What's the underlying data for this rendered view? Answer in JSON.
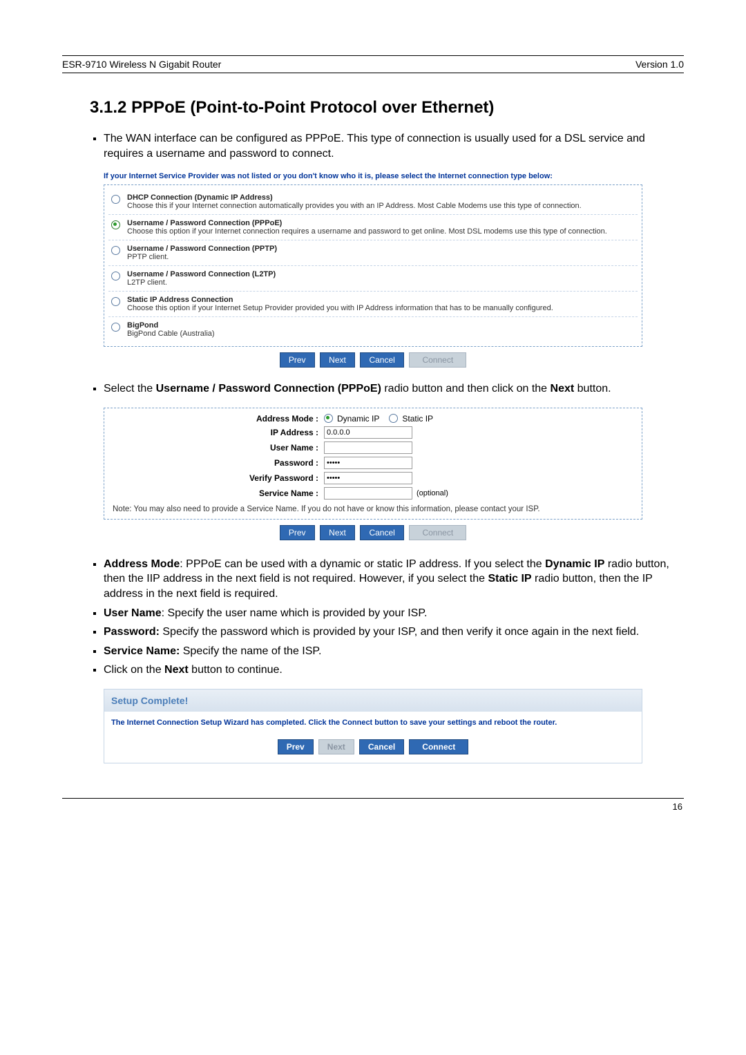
{
  "header": {
    "left": "ESR-9710 Wireless N Gigabit Router",
    "right": "Version 1.0"
  },
  "section": {
    "number": "3.1.2",
    "title": "PPPoE (Point-to-Point Protocol over Ethernet)"
  },
  "intro_bullet": "The WAN interface can be configured as PPPoE. This type of connection is usually used for a DSL service and requires a username and password to connect.",
  "wizard1": {
    "instruction": "If your Internet Service Provider was not listed or you don't know who it is, please select the Internet connection type below:",
    "options": [
      {
        "title": "DHCP Connection (Dynamic IP Address)",
        "desc": "Choose this if your Internet connection automatically provides you with an IP Address. Most Cable Modems use this type of connection.",
        "selected": false
      },
      {
        "title": "Username / Password Connection (PPPoE)",
        "desc": "Choose this option if your Internet connection requires a username and password to get online. Most DSL modems use this type of connection.",
        "selected": true
      },
      {
        "title": "Username / Password Connection (PPTP)",
        "desc": "PPTP client.",
        "selected": false
      },
      {
        "title": "Username / Password Connection (L2TP)",
        "desc": "L2TP client.",
        "selected": false
      },
      {
        "title": "Static IP Address Connection",
        "desc": "Choose this option if your Internet Setup Provider provided you with IP Address information that has to be manually configured.",
        "selected": false
      },
      {
        "title": "BigPond",
        "desc": "BigPond Cable (Australia)",
        "selected": false
      }
    ],
    "buttons": {
      "prev": "Prev",
      "next": "Next",
      "cancel": "Cancel",
      "connect": "Connect"
    }
  },
  "mid_bullet": {
    "prefix": "Select the ",
    "bold1": "Username / Password Connection (PPPoE)",
    "mid": " radio button and then click on the ",
    "bold2": "Next",
    "suffix": " button."
  },
  "form": {
    "labels": {
      "address_mode": "Address Mode :",
      "ip_address": "IP Address :",
      "user_name": "User Name :",
      "password": "Password :",
      "verify_password": "Verify Password :",
      "service_name": "Service Name :"
    },
    "address_mode": {
      "dynamic": "Dynamic IP",
      "static": "Static IP",
      "selected": "dynamic"
    },
    "ip_address_value": "0.0.0.0",
    "user_name_value": "",
    "password_value": "•••••",
    "verify_password_value": "•••••",
    "service_name_value": "",
    "service_name_hint": "(optional)",
    "note": "Note: You may also need to provide a Service Name. If you do not have or know this information, please contact your ISP.",
    "buttons": {
      "prev": "Prev",
      "next": "Next",
      "cancel": "Cancel",
      "connect": "Connect"
    }
  },
  "desc_list": {
    "addr_mode": {
      "bold": "Address Mode",
      "text": ": PPPoE can be used with a dynamic or static IP address. If you select the ",
      "bold2": "Dynamic IP",
      "text2": " radio button, then the IIP address in the next field is not required. However, if you select the ",
      "bold3": "Static IP",
      "text3": " radio button, then the IP address in the next field is required."
    },
    "user_name": {
      "bold": "User Name",
      "text": ": Specify the user name which is provided by your ISP."
    },
    "password": {
      "bold": "Password:",
      "text": " Specify the password which is provided by your ISP, and then verify it once again in the next field."
    },
    "service_name": {
      "bold": "Service Name:",
      "text": " Specify the name of the ISP."
    },
    "click_next": {
      "prefix": "Click on the ",
      "bold": "Next",
      "suffix": " button to continue."
    }
  },
  "complete": {
    "title": "Setup Complete!",
    "message": "The Internet Connection Setup Wizard has completed. Click the Connect button to save your settings and reboot the router.",
    "buttons": {
      "prev": "Prev",
      "next": "Next",
      "cancel": "Cancel",
      "connect": "Connect"
    }
  },
  "page_number": "16"
}
